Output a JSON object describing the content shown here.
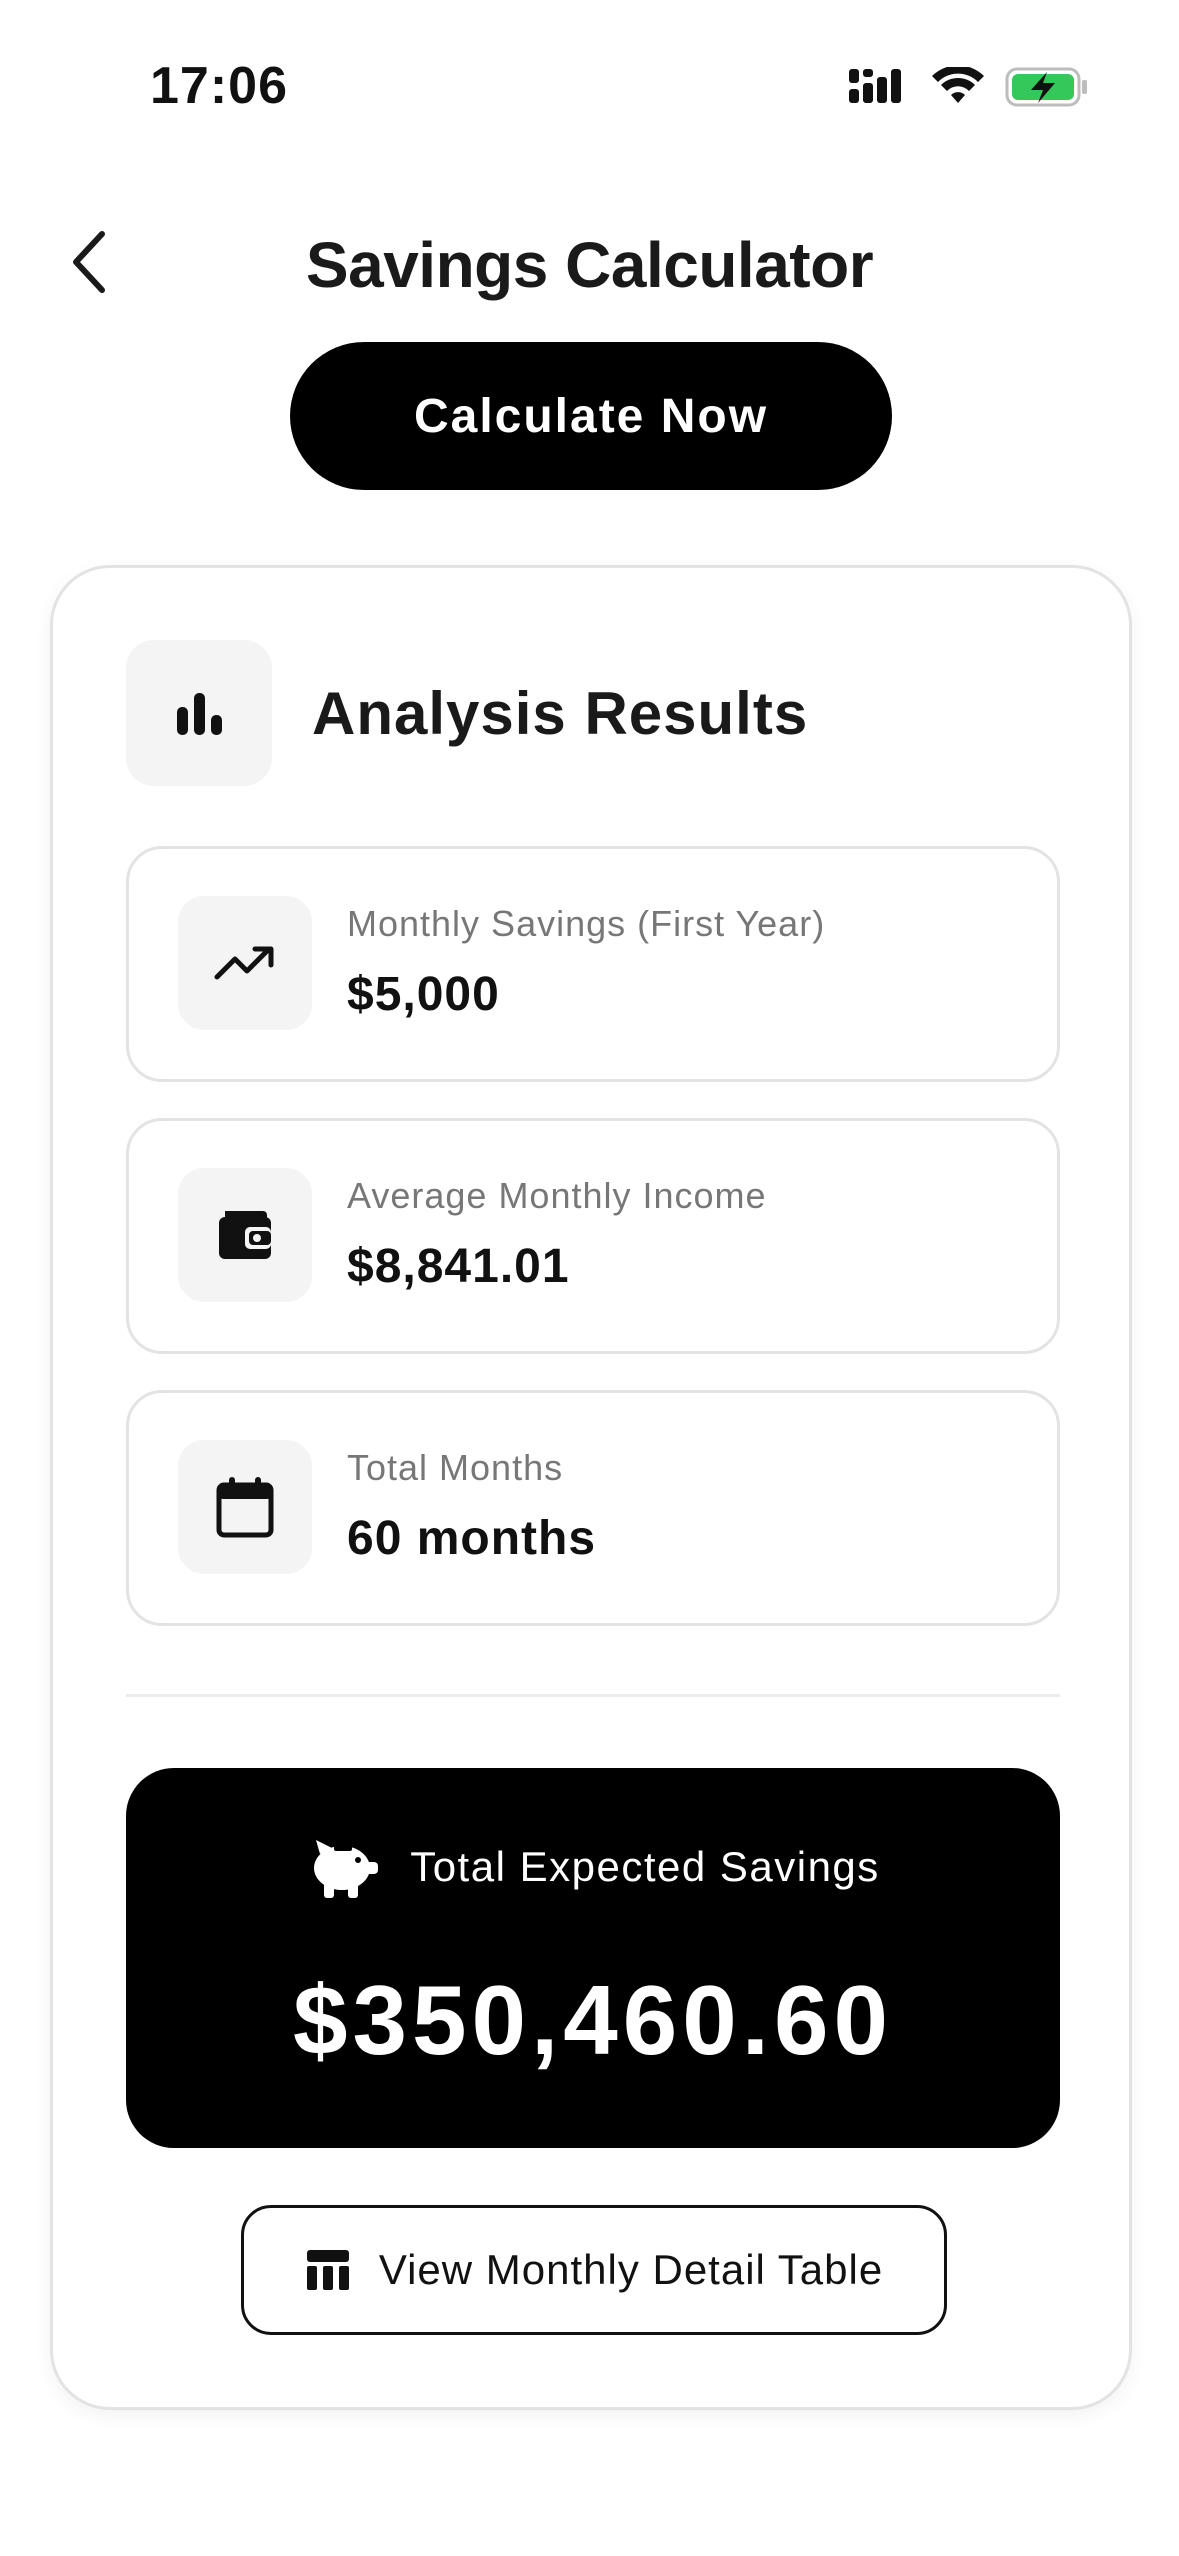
{
  "status_bar": {
    "time": "17:06"
  },
  "header": {
    "title": "Savings Calculator"
  },
  "calculate_label": "Calculate Now",
  "results": {
    "title": "Analysis Results",
    "stats": [
      {
        "label": "Monthly Savings (First Year)",
        "value": "$5,000",
        "icon": "trending-up-icon"
      },
      {
        "label": "Average Monthly Income",
        "value": "$8,841.01",
        "icon": "wallet-icon"
      },
      {
        "label": "Total Months",
        "value": "60 months",
        "icon": "calendar-icon"
      }
    ],
    "total": {
      "label": "Total Expected Savings",
      "value": "$350,460.60",
      "icon": "piggy-bank-icon"
    },
    "detail_button_label": "View Monthly Detail Table"
  },
  "colors": {
    "primary": "#000000",
    "text": "#1a1a1a",
    "muted": "#777777",
    "border": "#e3e3e3",
    "icon_bg": "#f4f4f4",
    "battery": "#34c759"
  }
}
